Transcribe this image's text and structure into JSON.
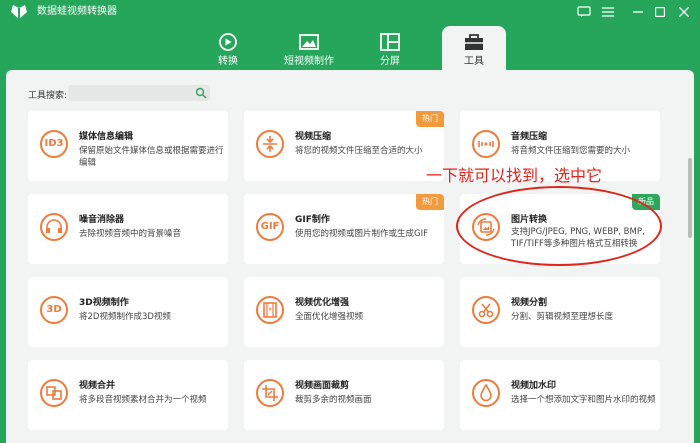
{
  "app": {
    "title": "数据蛙视频转换器"
  },
  "window_controls": [
    "feedback-icon",
    "menu-icon",
    "minimize-icon",
    "maximize-icon",
    "close-icon"
  ],
  "tabs": [
    {
      "label": "转换",
      "icon": "convert-icon",
      "active": false
    },
    {
      "label": "短视频制作",
      "icon": "short-video-icon",
      "active": false
    },
    {
      "label": "分屏",
      "icon": "split-screen-icon",
      "active": false
    },
    {
      "label": "工具",
      "icon": "toolbox-icon",
      "active": true
    }
  ],
  "search": {
    "label": "工具搜索:",
    "value": "",
    "placeholder": ""
  },
  "cards": [
    {
      "title": "媒体信息编辑",
      "desc": "保留原始文件媒体信息或根据需要进行编辑",
      "icon": "ID3",
      "badge": ""
    },
    {
      "title": "视频压缩",
      "desc": "将您的视频文件压缩至合适的大小",
      "icon": "compress-icon",
      "badge": "热门"
    },
    {
      "title": "音频压缩",
      "desc": "将音频文件压缩到您需要的大小",
      "icon": "audio-compress-icon",
      "badge": ""
    },
    {
      "title": "噪音消除器",
      "desc": "去除视频音频中的背景噪音",
      "icon": "headphones-icon",
      "badge": ""
    },
    {
      "title": "GIF制作",
      "desc": "使用您的视频或图片制作或生成GIF",
      "icon": "GIF",
      "badge": "热门"
    },
    {
      "title": "图片转换",
      "desc": "支持JPG/JPEG, PNG, WEBP, BMP, TIF/TIFF等多种图片格式互相转换",
      "icon": "image-convert-icon",
      "badge": "新品"
    },
    {
      "title": "3D视频制作",
      "desc": "将2D视频制作成3D视频",
      "icon": "3D",
      "badge": ""
    },
    {
      "title": "视频优化增强",
      "desc": "全面优化增强视频",
      "icon": "film-enhance-icon",
      "badge": ""
    },
    {
      "title": "视频分割",
      "desc": "分割、剪辑视频至理想长度",
      "icon": "scissors-icon",
      "badge": ""
    },
    {
      "title": "视频合并",
      "desc": "将多段音视频素材合并为一个视频",
      "icon": "merge-icon",
      "badge": ""
    },
    {
      "title": "视频画面裁剪",
      "desc": "裁剪多余的视频画面",
      "icon": "crop-icon",
      "badge": ""
    },
    {
      "title": "视频加水印",
      "desc": "选择一个想添加文字和图片水印的视频",
      "icon": "watermark-icon",
      "badge": ""
    }
  ],
  "annotation": {
    "text": "一下就可以找到，选中它"
  },
  "colors": {
    "brand": "#26a65b",
    "accent": "#f07a3b",
    "hot": "#f39a3c",
    "new": "#2fa65b",
    "annotation": "#e0251b"
  }
}
